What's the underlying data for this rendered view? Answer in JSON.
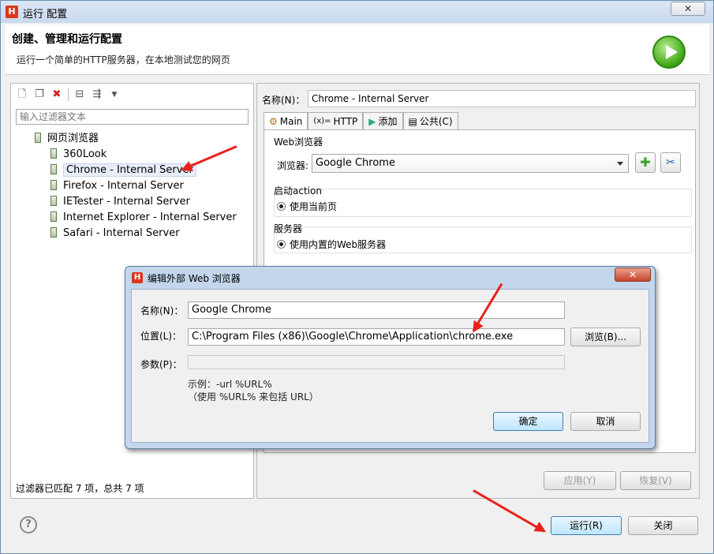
{
  "window": {
    "title": "运行 配置",
    "close_glyph": "✕"
  },
  "header": {
    "title": "创建、管理和运行配置",
    "description": "运行一个简单的HTTP服务器，在本地测试您的网页"
  },
  "left": {
    "filter_placeholder": "输入过滤器文本",
    "tree_root": "网页浏览器",
    "tree_items": [
      "360Look",
      "Chrome - Internal Server",
      "Firefox - Internal Server",
      "IETester - Internal Server",
      "Internet Explorer - Internal Server",
      "Safari - Internal Server"
    ],
    "status": "过滤器已匹配 7 项，总共 7 项"
  },
  "right": {
    "name_label": "名称(N)：",
    "name_value": "Chrome - Internal Server",
    "tabs": [
      "Main",
      "HTTP",
      "添加",
      "公共(C)"
    ],
    "web_browser_group": "Web浏览器",
    "browser_label": "浏览器:",
    "browser_value": "Google Chrome",
    "startup_group": "启动action",
    "startup_option": "使用当前页",
    "server_group": "服务器",
    "server_option": "使用内置的Web服务器",
    "apply_label": "应用(Y)",
    "revert_label": "恢复(V)"
  },
  "footer": {
    "run_label": "运行(R)",
    "close_label": "关闭"
  },
  "dialog": {
    "title": "编辑外部 Web 浏览器",
    "name_label": "名称(N)：",
    "name_value": "Google Chrome",
    "location_label": "位置(L)：",
    "location_value": "C:\\Program Files (x86)\\Google\\Chrome\\Application\\chrome.exe",
    "browse_label": "浏览(B)...",
    "params_label": "参数(P)：",
    "params_value": "",
    "example_line1": "示例：-url %URL%",
    "example_line2": "（使用 %URL% 来包括 URL）",
    "ok_label": "确定",
    "cancel_label": "取消"
  },
  "colors": {
    "annotation_arrow": "#e8221a",
    "run_icon": "#3da515"
  }
}
